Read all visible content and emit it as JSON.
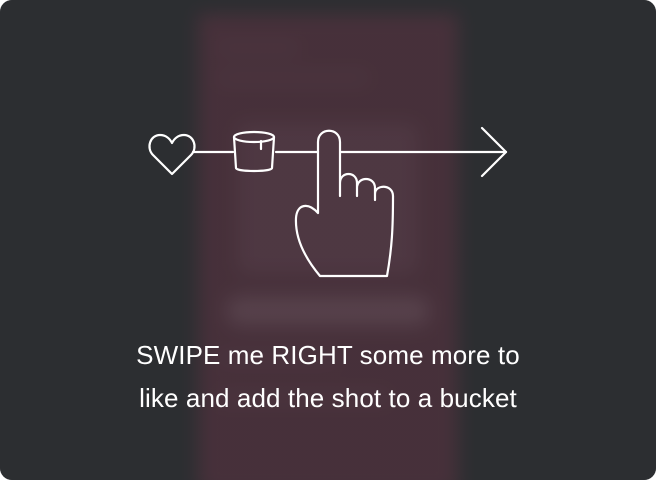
{
  "overlay": {
    "message_line1": "SWIPE me RIGHT some more to",
    "message_line2": "like and add the shot to a bucket"
  },
  "illustration": {
    "icons": [
      "heart-icon",
      "bucket-icon",
      "hand-pointer-icon",
      "arrow-right-icon"
    ],
    "stroke_color": "#ffffff"
  },
  "background": {
    "overlay_color": "#2c2e31",
    "blurred_screen_color": "#6b3447"
  }
}
